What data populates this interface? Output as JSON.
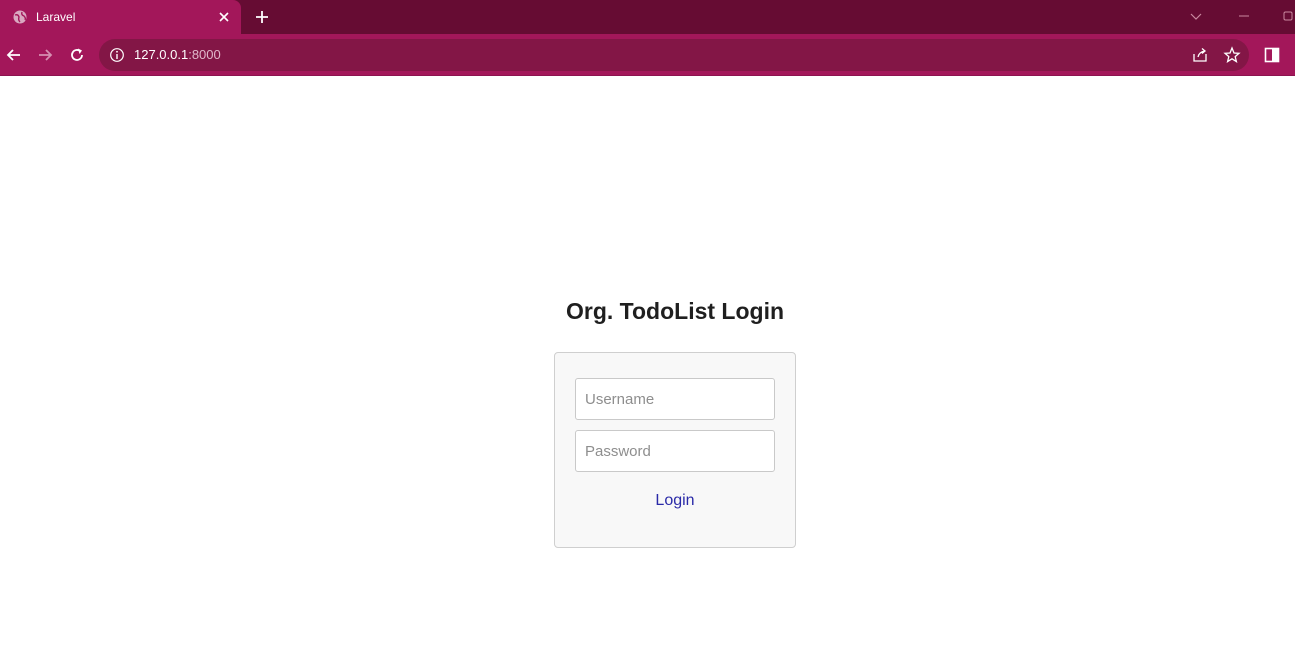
{
  "browser": {
    "tab": {
      "title": "Laravel",
      "favicon": "globe-icon",
      "close_icon": "close-icon"
    },
    "new_tab_icon": "plus-icon",
    "window_controls": [
      "chevron-down-icon",
      "minimize-icon",
      "restore-icon"
    ],
    "address_bar": {
      "host": "127.0.0.1",
      "port": ":8000"
    },
    "colors": {
      "tab_strip": "#660c33",
      "active_tab": "#a3175a",
      "toolbar": "#a3175a",
      "omnibox": "#831646"
    }
  },
  "page": {
    "title": "Org. TodoList Login",
    "form": {
      "username_placeholder": "Username",
      "password_placeholder": "Password",
      "login_label": "Login"
    },
    "colors": {
      "card_background": "#f8f8f8",
      "login_link": "#2a2aa8"
    }
  }
}
